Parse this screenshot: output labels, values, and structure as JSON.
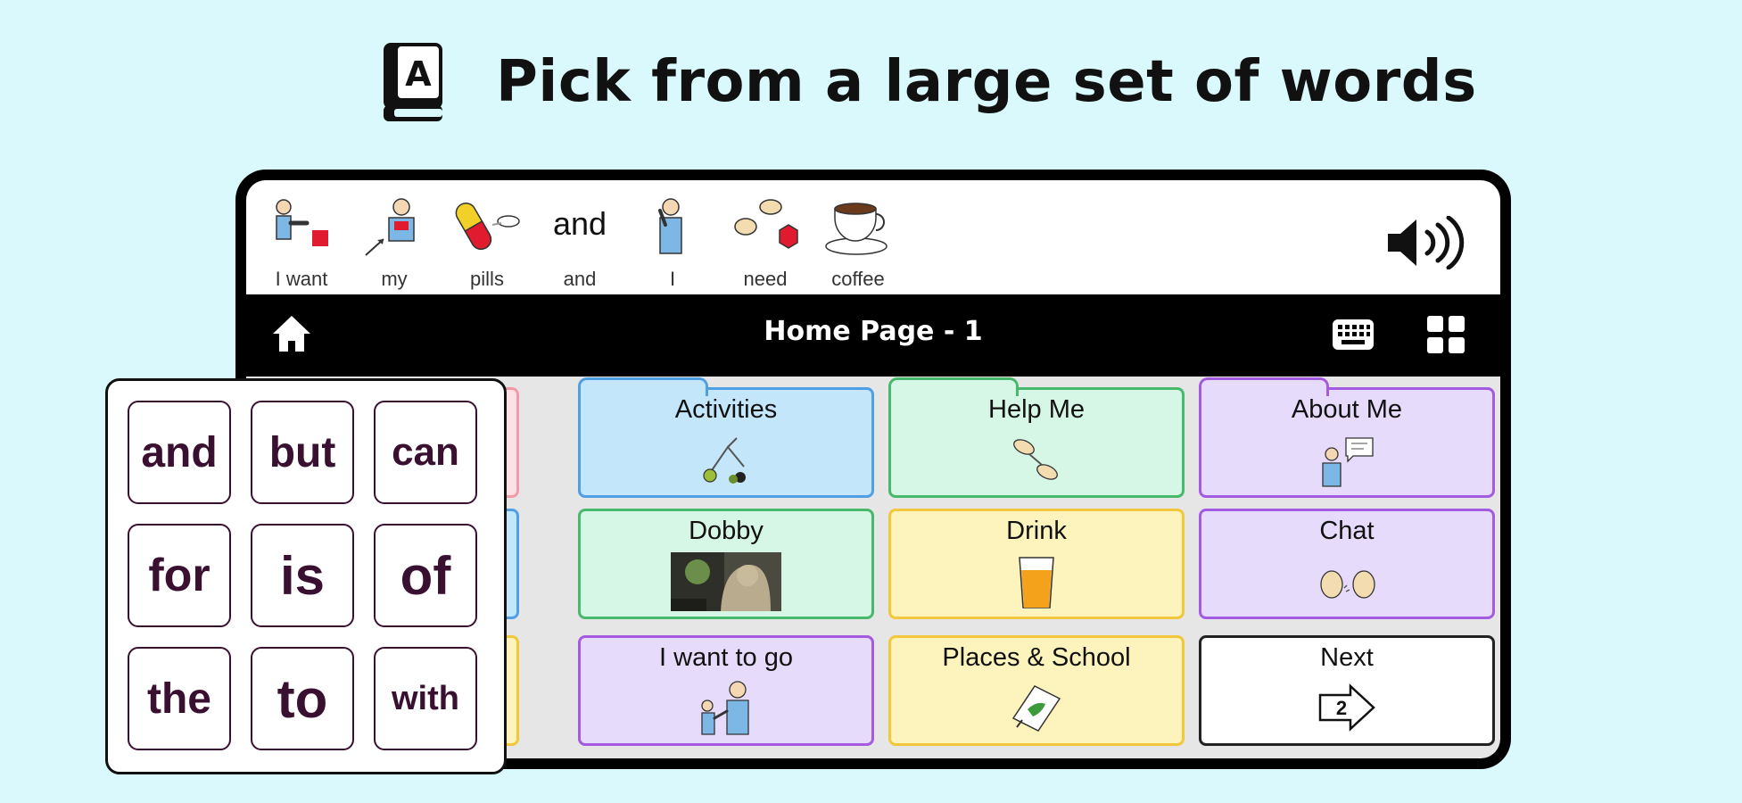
{
  "heading": {
    "text": "Pick from a large set of words",
    "icon": "book-letter-a-icon"
  },
  "sentence": {
    "words": [
      {
        "label": "I want",
        "icon": "i-want-icon"
      },
      {
        "label": "my",
        "icon": "my-icon"
      },
      {
        "label": "pills",
        "icon": "pills-icon"
      },
      {
        "label": "and",
        "symbol_text": "and"
      },
      {
        "label": "I",
        "icon": "person-i-icon"
      },
      {
        "label": "need",
        "icon": "need-icon"
      },
      {
        "label": "coffee",
        "icon": "coffee-cup-icon"
      }
    ],
    "speak_icon": "speaker-icon"
  },
  "nav": {
    "title": "Home Page - 1",
    "home_icon": "home-icon",
    "keyboard_icon": "keyboard-icon",
    "grid_icon": "grid-icon"
  },
  "tiles": [
    {
      "label": "Activities",
      "icon": "activities-icon",
      "color": "#c4e6fb",
      "border": "#4f9fe3"
    },
    {
      "label": "Help Me",
      "icon": "help-me-icon",
      "color": "#d6f7e6",
      "border": "#47b86c"
    },
    {
      "label": "About Me",
      "icon": "about-me-icon",
      "color": "#e6dbfa",
      "border": "#a55be0"
    },
    {
      "label": "Dobby",
      "icon": "dobby-photo",
      "color": "#d6f7e6",
      "border": "#47b86c"
    },
    {
      "label": "Drink",
      "icon": "drink-glass-icon",
      "color": "#fdf3bd",
      "border": "#f2c73b"
    },
    {
      "label": "Chat",
      "icon": "chat-icon",
      "color": "#e6dbfa",
      "border": "#a55be0"
    },
    {
      "label": "I want to go",
      "icon": "i-want-to-go-icon",
      "color": "#e6dbfa",
      "border": "#a55be0"
    },
    {
      "label": "Places & School",
      "icon": "places-map-icon",
      "color": "#fdf3bd",
      "border": "#f2c73b"
    },
    {
      "label": "Next",
      "icon": "next-arrow-icon",
      "next_number": "2",
      "color": "#ffffff",
      "border": "#222222"
    }
  ],
  "word_panel": {
    "words": [
      "and",
      "but",
      "can",
      "for",
      "is",
      "of",
      "the",
      "to",
      "with"
    ]
  }
}
